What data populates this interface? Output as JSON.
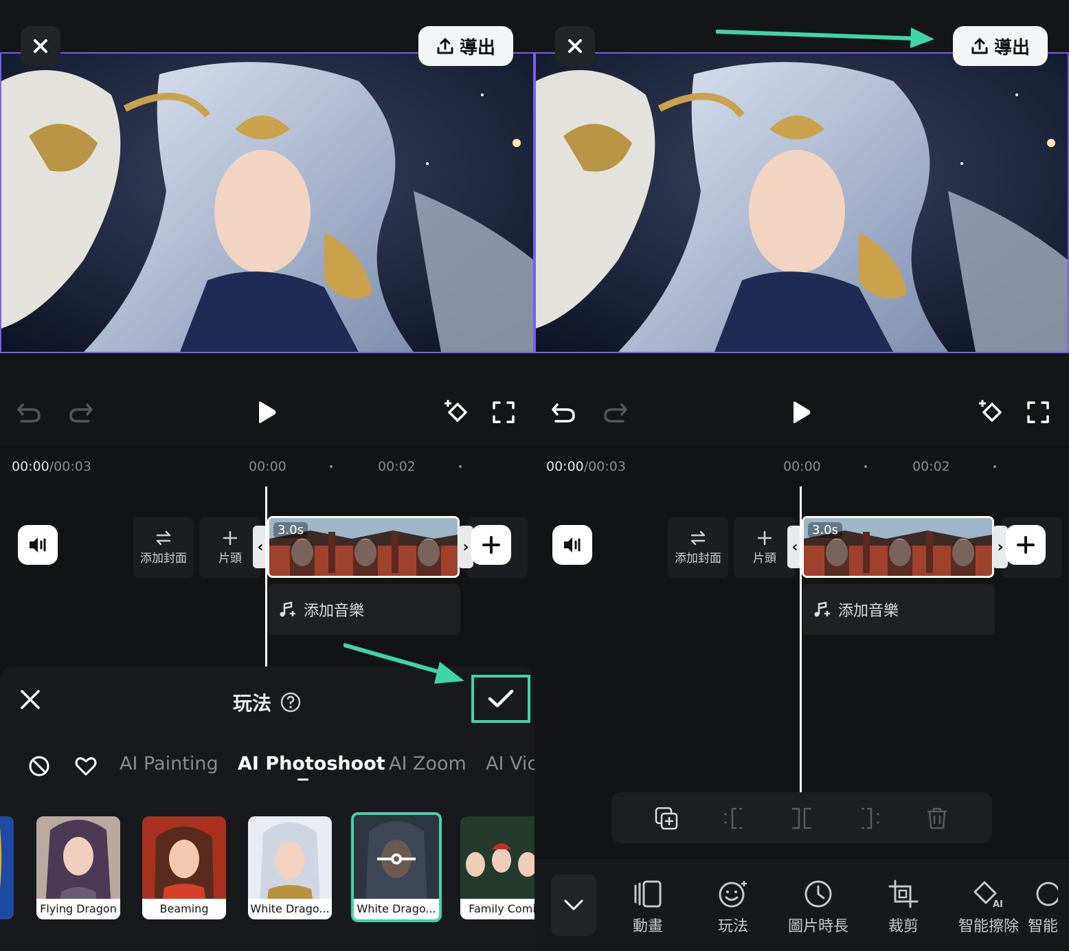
{
  "left_panel": {
    "export_label": "導出",
    "time_current": "00:00",
    "time_total": "/00:03",
    "ticks": [
      "00:00",
      "00:02"
    ],
    "add_cover_label": "添加封面",
    "intro_label": "片頭",
    "clip_duration": "3.0s",
    "add_music_label": "添加音樂",
    "sheet": {
      "title": "玩法",
      "tabs": [
        "AI Painting",
        "AI Photoshoot",
        "AI Zoom",
        "AI Vic"
      ],
      "active_tab": "AI Photoshoot",
      "templates": [
        "Flying Dragon",
        "Beaming",
        "White Drago...",
        "White Drago...",
        "Family Comi"
      ]
    }
  },
  "right_panel": {
    "export_label": "導出",
    "time_current": "00:00",
    "time_total": "/00:03",
    "ticks": [
      "00:00",
      "00:02"
    ],
    "add_cover_label": "添加封面",
    "intro_label": "片頭",
    "clip_duration": "3.0s",
    "add_music_label": "添加音樂",
    "tools": [
      "動畫",
      "玩法",
      "圖片時長",
      "裁剪",
      "智能擦除",
      "智能"
    ]
  },
  "colors": {
    "accent_highlight": "#3ed6a8",
    "preview_border": "#7b5cf6",
    "background": "#141517"
  },
  "icons": [
    "close-icon",
    "upload-icon",
    "undo-icon",
    "redo-icon",
    "play-icon",
    "keyframe-icon",
    "fullscreen-icon",
    "volume-icon",
    "swap-icon",
    "plus-icon",
    "music-note-icon",
    "help-icon",
    "check-icon",
    "none-icon",
    "heart-icon",
    "copy-icon",
    "split-left-icon",
    "split-icon",
    "split-right-icon",
    "trash-icon",
    "chevron-down-icon",
    "animation-icon",
    "effects-icon",
    "clock-icon",
    "crop-icon",
    "ai-erase-icon"
  ]
}
